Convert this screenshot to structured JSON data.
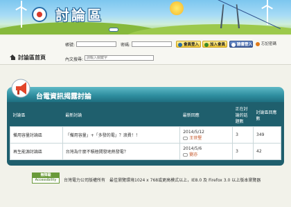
{
  "banner": {
    "title": "討論區"
  },
  "login": {
    "account_label": "帳號:",
    "password_label": "密碼:",
    "account_value": "",
    "password_value": "",
    "member_login": "會員登入",
    "join_member": "加入會員",
    "fb_login": "臉書登入",
    "forgot_password": "忘記密碼",
    "search_label": "內文搜尋:",
    "search_placeholder": "請輸入關鍵字"
  },
  "nav": {
    "home": "討論區首頁"
  },
  "panel": {
    "title": "台電資訊揭露討論",
    "columns": [
      "討論區",
      "最新討論",
      "最新回應",
      "正在討論的話題數",
      "討論區回應數"
    ],
    "rows": [
      {
        "forum": "備用容量討論區",
        "latest": "「備用容量」+「多發的電」？浪費！！",
        "date": "2014/5/12",
        "user": "王世堅",
        "topics": "3",
        "replies": "349"
      },
      {
        "forum": "再生能源討論區",
        "latest": "台灣為什麼不積極開發地熱發電？",
        "date": "2014/5/6",
        "user": "劉亦",
        "topics": "3",
        "replies": "42"
      }
    ]
  },
  "footer": {
    "access_top": "無障礙",
    "access_bottom": "Accessibility",
    "text": "台灣電力公司版權所有　最佳瀏覽環境1024 x 768或更高模式以上，IE8.0 及 Firefox 3.0 以上版本瀏覽器"
  },
  "colors": {
    "panel_teal": "#1f5f6d",
    "header_teal": "#2f8fa0",
    "accent_yellow": "#f0c834",
    "fb_blue": "#3b5998"
  },
  "icons": [
    "logo",
    "home-icon",
    "megaphone-icon",
    "chat-icon",
    "key-icon",
    "facebook-icon",
    "user-icon"
  ]
}
